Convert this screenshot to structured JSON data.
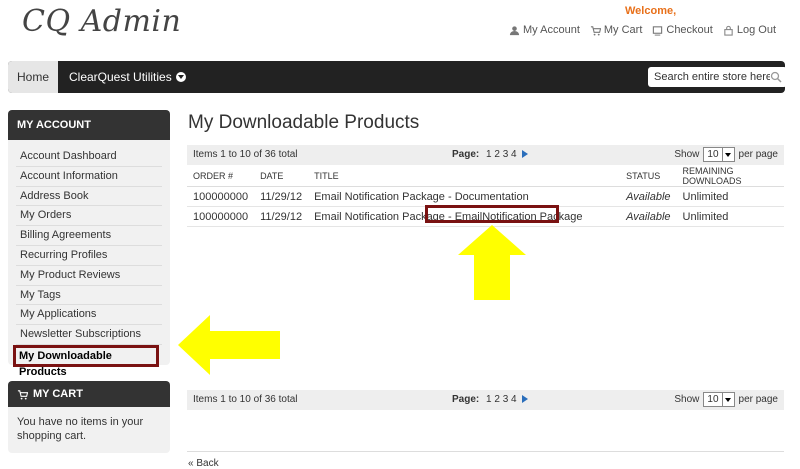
{
  "header": {
    "logo": "CQ Admin",
    "welcome": "Welcome,",
    "links": [
      "My Account",
      "My Cart",
      "Checkout",
      "Log Out"
    ]
  },
  "nav": {
    "home": "Home",
    "menu": "ClearQuest Utilities",
    "search_placeholder": "Search entire store here"
  },
  "sidebar": {
    "title": "MY ACCOUNT",
    "items": [
      "Account Dashboard",
      "Account Information",
      "Address Book",
      "My Orders",
      "Billing Agreements",
      "Recurring Profiles",
      "My Product Reviews",
      "My Tags",
      "My Applications",
      "Newsletter Subscriptions",
      "My Downloadable Products"
    ]
  },
  "cart": {
    "title": "MY CART",
    "text": "You have no items in your shopping cart."
  },
  "main": {
    "title": "My Downloadable Products",
    "pager": {
      "items": "Items 1 to 10 of 36 total",
      "page_label": "Page:",
      "pages": [
        "1",
        "2",
        "3",
        "4"
      ],
      "show": "Show",
      "per_page_value": "10",
      "per_page": "per page"
    },
    "columns": [
      "ORDER #",
      "DATE",
      "TITLE",
      "STATUS",
      "REMAINING DOWNLOADS"
    ],
    "rows": [
      {
        "order": "100000000",
        "date": "11/29/12",
        "title": "Email Notification Package - Documentation",
        "status": "Available",
        "remaining": "Unlimited"
      },
      {
        "order": "100000000",
        "date": "11/29/12",
        "title": "Email Notification Package - EmailNotification Package",
        "status": "Available",
        "remaining": "Unlimited"
      }
    ],
    "back": "« Back"
  },
  "colors": {
    "accent": "#e8701a",
    "highlight": "#7a1212",
    "arrow": "#ffff00"
  }
}
